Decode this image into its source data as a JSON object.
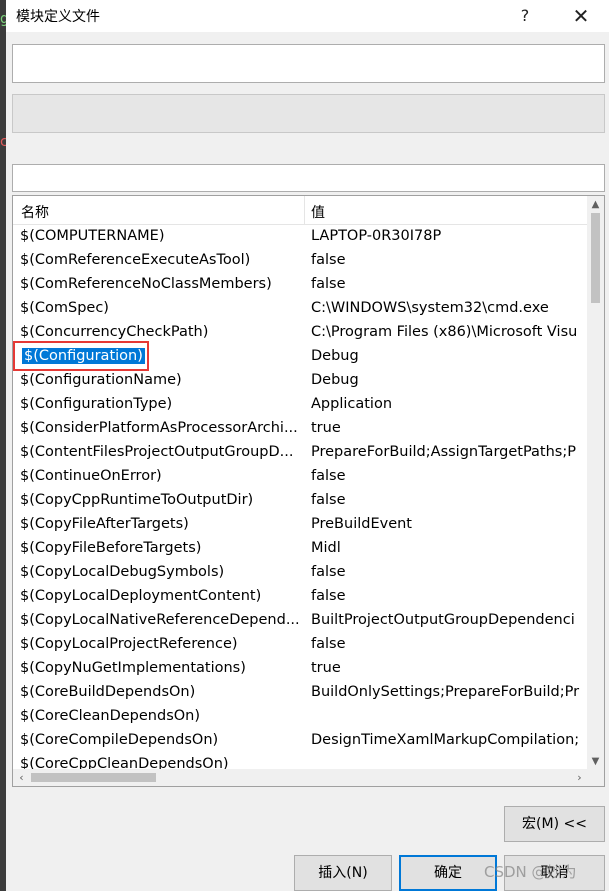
{
  "window": {
    "title": "模块定义文件",
    "help_label": "?",
    "close_label": "✕"
  },
  "edge_glyphs": [
    "g",
    "c"
  ],
  "accent_color": "#0078d7",
  "highlight_frame_color": "#e53935",
  "grid": {
    "headers": {
      "name": "名称",
      "value": "值"
    },
    "rows": [
      {
        "name": "$(COMPUTERNAME)",
        "value": "LAPTOP-0R30I78P"
      },
      {
        "name": "$(ComReferenceExecuteAsTool)",
        "value": "false"
      },
      {
        "name": "$(ComReferenceNoClassMembers)",
        "value": "false"
      },
      {
        "name": "$(ComSpec)",
        "value": "C:\\WINDOWS\\system32\\cmd.exe"
      },
      {
        "name": "$(ConcurrencyCheckPath)",
        "value": "C:\\Program Files (x86)\\Microsoft Visu"
      },
      {
        "name": "$(Configuration)",
        "value": "Debug"
      },
      {
        "name": "$(ConfigurationName)",
        "value": "Debug"
      },
      {
        "name": "$(ConfigurationType)",
        "value": "Application"
      },
      {
        "name": "$(ConsiderPlatformAsProcessorArchi...",
        "value": "true"
      },
      {
        "name": "$(ContentFilesProjectOutputGroupD...",
        "value": "PrepareForBuild;AssignTargetPaths;P"
      },
      {
        "name": "$(ContinueOnError)",
        "value": "false"
      },
      {
        "name": "$(CopyCppRuntimeToOutputDir)",
        "value": "false"
      },
      {
        "name": "$(CopyFileAfterTargets)",
        "value": "PreBuildEvent"
      },
      {
        "name": "$(CopyFileBeforeTargets)",
        "value": "Midl"
      },
      {
        "name": "$(CopyLocalDebugSymbols)",
        "value": "false"
      },
      {
        "name": "$(CopyLocalDeploymentContent)",
        "value": "false"
      },
      {
        "name": "$(CopyLocalNativeReferenceDepend...",
        "value": "BuiltProjectOutputGroupDependenci"
      },
      {
        "name": "$(CopyLocalProjectReference)",
        "value": "false"
      },
      {
        "name": "$(CopyNuGetImplementations)",
        "value": "true"
      },
      {
        "name": "$(CoreBuildDependsOn)",
        "value": "BuildOnlySettings;PrepareForBuild;Pr"
      },
      {
        "name": "$(CoreCleanDependsOn)",
        "value": ""
      },
      {
        "name": "$(CoreCompileDependsOn)",
        "value": "DesignTimeXamlMarkupCompilation;"
      },
      {
        "name": "$(CoreCppCleanDependsOn)",
        "value": ""
      }
    ]
  },
  "buttons": {
    "macro": "宏(M) <<",
    "insert": "插入(N)",
    "ok": "确定",
    "cancel": "取消"
  },
  "watermark": "CSDN @妙为"
}
